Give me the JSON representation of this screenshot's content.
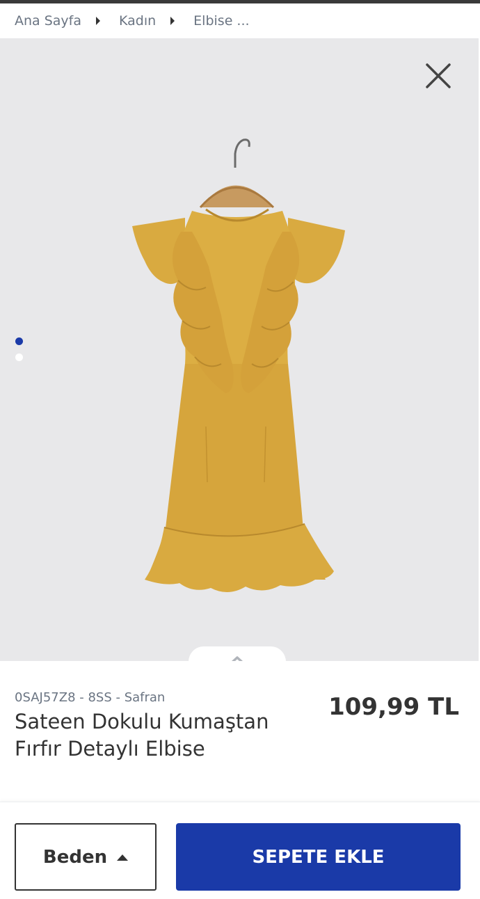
{
  "breadcrumb": {
    "items": [
      {
        "label": "Ana Sayfa"
      },
      {
        "label": "Kadın"
      },
      {
        "label": "Elbise ..."
      }
    ]
  },
  "gallery": {
    "image_count": 2,
    "active_index": 0,
    "close_icon": "close-icon",
    "expand_icon": "chevron-up-icon",
    "image_alt": "dress-image"
  },
  "product": {
    "sku": "0SAJ57Z8 - 8SS - Safran",
    "title": "Sateen Dokulu Kumaştan Fırfır Detaylı Elbise",
    "price": "109,99 TL"
  },
  "actions": {
    "size_label": "Beden",
    "add_to_cart_label": "SEPETE EKLE"
  },
  "colors": {
    "accent": "#1a3aa8",
    "dress": "#dcae43",
    "gallery_bg": "#e8e8ea",
    "muted_text": "#6a7482"
  }
}
